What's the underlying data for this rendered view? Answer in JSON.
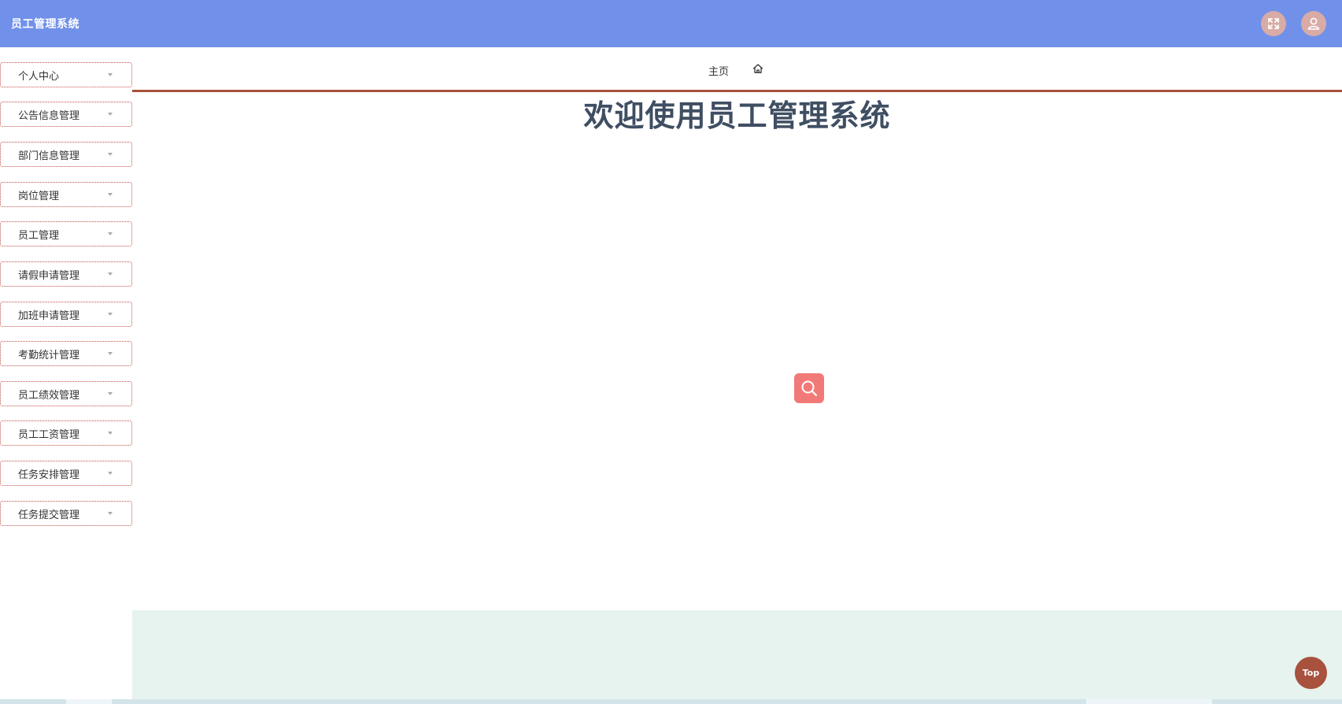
{
  "header": {
    "title": "员工管理系统",
    "fullscreen_icon": "fullscreen-icon",
    "user_icon": "user-icon",
    "background_color": "#7190ea",
    "button_color": "#d9aba6"
  },
  "sidebar": {
    "items": [
      {
        "label": "个人中心"
      },
      {
        "label": "公告信息管理"
      },
      {
        "label": "部门信息管理"
      },
      {
        "label": "岗位管理"
      },
      {
        "label": "员工管理"
      },
      {
        "label": "请假申请管理"
      },
      {
        "label": "加班申请管理"
      },
      {
        "label": "考勤统计管理"
      },
      {
        "label": "员工绩效管理"
      },
      {
        "label": "员工工资管理"
      },
      {
        "label": "任务安排管理"
      },
      {
        "label": "任务提交管理"
      }
    ],
    "border_color": "#c0514a"
  },
  "breadcrumb": {
    "home_label": "主页",
    "home_icon": "home-icon",
    "accent_color": "#a8513d"
  },
  "main": {
    "welcome_text": "欢迎使用员工管理系统",
    "search_icon": "search-icon",
    "search_button_color": "#f17a78"
  },
  "back_to_top": {
    "label": "Top",
    "color": "#a8513d"
  }
}
